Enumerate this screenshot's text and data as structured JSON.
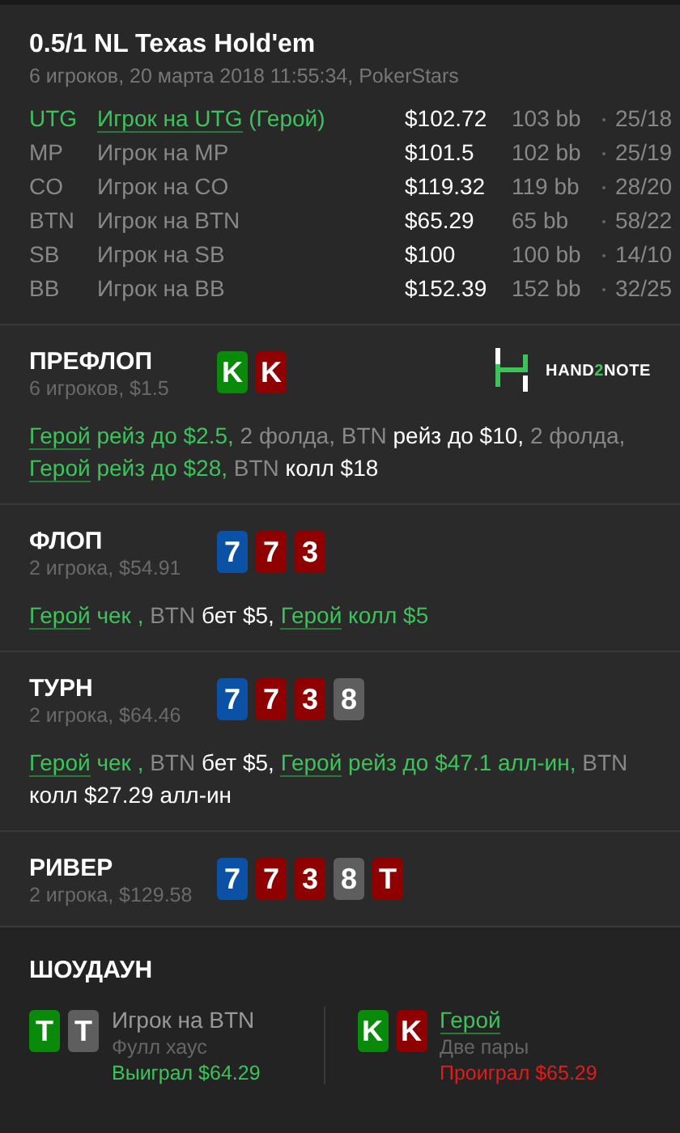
{
  "header": {
    "title": "0.5/1 NL Texas Hold'em",
    "subtitle": "6 игроков, 20 марта 2018 11:55:34, PokerStars"
  },
  "players": [
    {
      "position": "UTG",
      "name": "Игрок на UTG",
      "hero": true,
      "hero_tag": "(Герой)",
      "stack": "$102.72",
      "bb": "103 bb",
      "stats": "25/18"
    },
    {
      "position": "MP",
      "name": "Игрок на MP",
      "hero": false,
      "stack": "$101.5",
      "bb": "102 bb",
      "stats": "25/19"
    },
    {
      "position": "CO",
      "name": "Игрок на CO",
      "hero": false,
      "stack": "$119.32",
      "bb": "119 bb",
      "stats": "28/20"
    },
    {
      "position": "BTN",
      "name": "Игрок на BTN",
      "hero": false,
      "stack": "$65.29",
      "bb": "65 bb",
      "stats": "58/22"
    },
    {
      "position": "SB",
      "name": "Игрок на SB",
      "hero": false,
      "stack": "$100",
      "bb": "100 bb",
      "stats": "14/10"
    },
    {
      "position": "BB",
      "name": "Игрок на BB",
      "hero": false,
      "stack": "$152.39",
      "bb": "152 bb",
      "stats": "32/25"
    }
  ],
  "streets": [
    {
      "title": "ПРЕФЛОП",
      "info": "6 игроков, $1.5",
      "cards": [
        {
          "rank": "K",
          "color": "#0a8a0a"
        },
        {
          "rank": "K",
          "color": "#8f0000"
        }
      ],
      "logo": [
        "HAND",
        "2",
        "NOTE"
      ],
      "actions": [
        {
          "text": "Герой",
          "kind": "hero"
        },
        {
          "text": "рейз до $2.5,",
          "kind": "hero-action"
        },
        {
          "text": "2 фолда, BTN",
          "kind": "other"
        },
        {
          "text": "рейз до $10,",
          "kind": "action"
        },
        {
          "text": "2 фолда,",
          "kind": "other"
        },
        {
          "text": "Герой",
          "kind": "hero"
        },
        {
          "text": "рейз до $28,",
          "kind": "hero-action"
        },
        {
          "text": "BTN",
          "kind": "other"
        },
        {
          "text": "колл $18",
          "kind": "action"
        }
      ]
    },
    {
      "title": "ФЛОП",
      "info": "2 игрока, $54.91",
      "cards": [
        {
          "rank": "7",
          "color": "#0b52a6"
        },
        {
          "rank": "7",
          "color": "#8f0000"
        },
        {
          "rank": "3",
          "color": "#8f0000"
        }
      ],
      "actions": [
        {
          "text": "Герой",
          "kind": "hero"
        },
        {
          "text": "чек ,",
          "kind": "hero-action"
        },
        {
          "text": "BTN",
          "kind": "other"
        },
        {
          "text": "бет $5,",
          "kind": "action"
        },
        {
          "text": "Герой",
          "kind": "hero"
        },
        {
          "text": "колл $5",
          "kind": "hero-action"
        }
      ]
    },
    {
      "title": "ТУРН",
      "info": "2 игрока, $64.46",
      "cards": [
        {
          "rank": "7",
          "color": "#0b52a6"
        },
        {
          "rank": "7",
          "color": "#8f0000"
        },
        {
          "rank": "3",
          "color": "#8f0000"
        },
        {
          "rank": "8",
          "color": "#5e5e5e"
        }
      ],
      "actions": [
        {
          "text": "Герой",
          "kind": "hero"
        },
        {
          "text": "чек ,",
          "kind": "hero-action"
        },
        {
          "text": "BTN",
          "kind": "other"
        },
        {
          "text": "бет $5,",
          "kind": "action"
        },
        {
          "text": "Герой",
          "kind": "hero"
        },
        {
          "text": "рейз до $47.1 алл-ин,",
          "kind": "hero-action"
        },
        {
          "text": "BTN",
          "kind": "other"
        },
        {
          "text": "колл $27.29 алл-ин",
          "kind": "action"
        }
      ]
    },
    {
      "title": "РИВЕР",
      "info": "2 игрока, $129.58",
      "cards": [
        {
          "rank": "7",
          "color": "#0b52a6"
        },
        {
          "rank": "7",
          "color": "#8f0000"
        },
        {
          "rank": "3",
          "color": "#8f0000"
        },
        {
          "rank": "8",
          "color": "#5e5e5e"
        },
        {
          "rank": "T",
          "color": "#8f0000"
        }
      ]
    }
  ],
  "showdown": {
    "title": "ШОУДАУН",
    "hands": [
      {
        "cards": [
          {
            "rank": "T",
            "color": "#0a8a0a"
          },
          {
            "rank": "T",
            "color": "#5e5e5e"
          }
        ],
        "name": "Игрок на BTN",
        "hero": false,
        "combo": "Фулл хаус",
        "result": "Выиграл $64.29",
        "won": true
      },
      {
        "cards": [
          {
            "rank": "K",
            "color": "#0a8a0a"
          },
          {
            "rank": "K",
            "color": "#8f0000"
          }
        ],
        "name": "Герой",
        "hero": true,
        "combo": "Две пары",
        "result": "Проиграл $65.29",
        "won": false
      }
    ]
  }
}
